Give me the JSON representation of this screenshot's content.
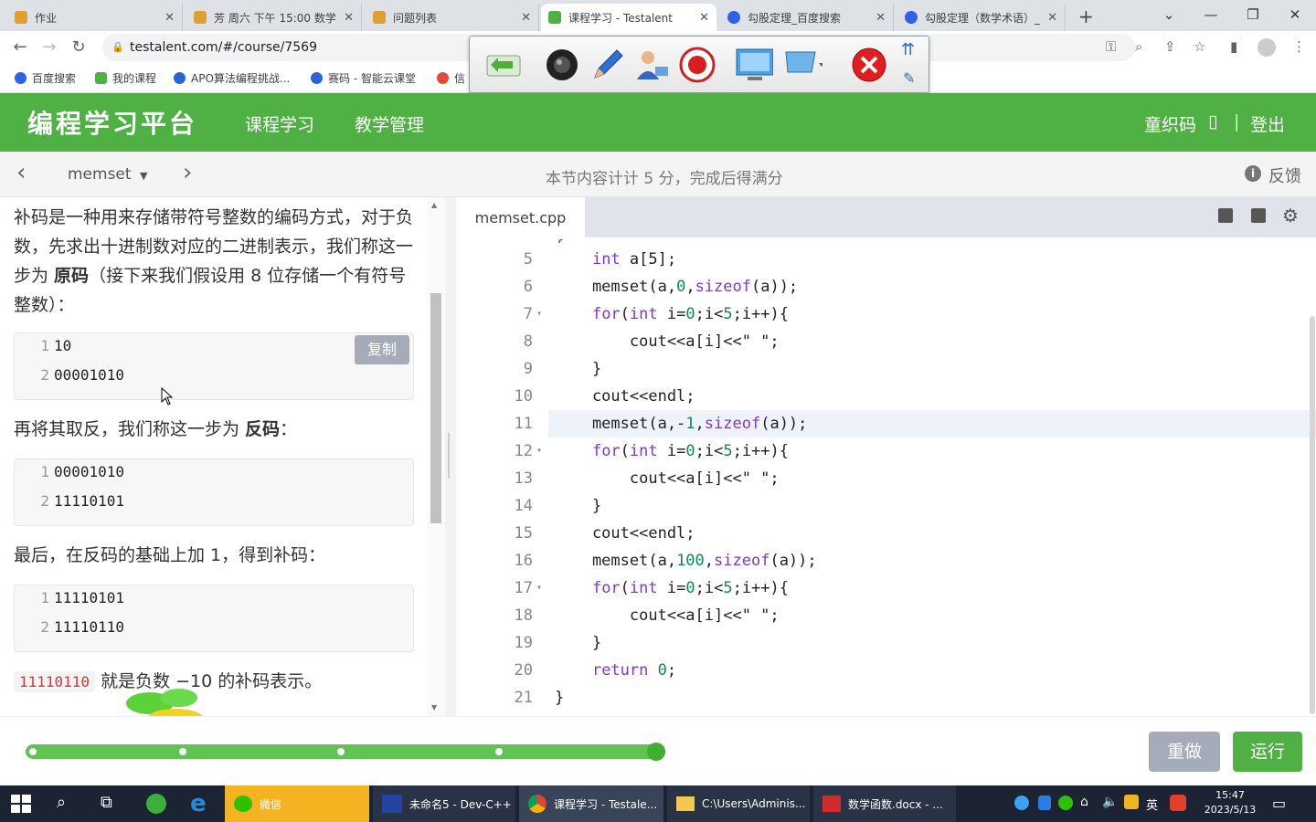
{
  "browser": {
    "tabs": [
      {
        "title": "作业",
        "color": "#e0a030"
      },
      {
        "title": "芳 周六 下午 15:00 数学",
        "color": "#e0a030"
      },
      {
        "title": "问题列表",
        "color": "#e0a030"
      },
      {
        "title": "课程学习 - Testalent",
        "color": "#4fb043",
        "active": true
      },
      {
        "title": "勾股定理_百度搜索",
        "color": "#3062e6"
      },
      {
        "title": "勾股定理（数学术语）_",
        "color": "#3062e6"
      }
    ],
    "new_tab": "+",
    "url": "testalent.com/#/course/7569",
    "bookmarks": [
      {
        "label": "百度搜索",
        "color": "#3062e6"
      },
      {
        "label": "我的课程",
        "color": "#4fb043"
      },
      {
        "label": "APO算法编程挑战...",
        "color": "#2b63d8"
      },
      {
        "label": "赛码 - 智能云课堂",
        "color": "#2b63d8"
      },
      {
        "label": "信",
        "color": "#e04a3a"
      }
    ]
  },
  "app": {
    "logo": "编程学习平台",
    "nav": [
      "课程学习",
      "教学管理"
    ],
    "user": "童织码",
    "user_icon": "▯",
    "separator": "|",
    "logout": "登出"
  },
  "subbar": {
    "prev": "‹",
    "next": "›",
    "lesson": "memset",
    "caret": "▼",
    "score_note": "本节内容计计 5 分，完成后得满分",
    "feedback_icon": "i",
    "feedback": "反馈"
  },
  "lesson": {
    "p1_a": "补码是一种用来存储带符号整数的编码方式，对于负数，先求出十进制数对应的二进制表示，我们称这一步为 ",
    "p1_bold": "原码",
    "p1_b": "（接下来我们假设用 8 位存储一个有符号整数）：",
    "block1": [
      {
        "n": "1",
        "t": "10"
      },
      {
        "n": "2",
        "t": "00001010"
      }
    ],
    "copy": "复制",
    "p2_a": "再将其取反，我们称这一步为 ",
    "p2_bold": "反码",
    "p2_b": "：",
    "block2": [
      {
        "n": "1",
        "t": "00001010"
      },
      {
        "n": "2",
        "t": "11110101"
      }
    ],
    "p3": "最后，在反码的基础上加 1，得到补码：",
    "block3": [
      {
        "n": "1",
        "t": "11110101"
      },
      {
        "n": "2",
        "t": "11110110"
      }
    ],
    "code_inline": "11110110",
    "p4": " 就是负数 −10 的补码表示。"
  },
  "editor": {
    "filename": "memset.cpp",
    "lines": [
      {
        "n": "5",
        "fold": "",
        "html": "    <span class='kw'>int</span> a[5];"
      },
      {
        "n": "6",
        "fold": "",
        "html": "    memset(a,<span class='num'>0</span>,<span class='kw'>sizeof</span>(a));"
      },
      {
        "n": "7",
        "fold": "▾",
        "html": "    <span class='kw'>for</span>(<span class='kw'>int</span> i=<span class='num'>0</span>;i&lt;<span class='num'>5</span>;i++){"
      },
      {
        "n": "8",
        "fold": "",
        "html": "        cout&lt;&lt;a[i]&lt;&lt;<span class='str'>\" \"</span>;"
      },
      {
        "n": "9",
        "fold": "",
        "html": "    }"
      },
      {
        "n": "10",
        "fold": "",
        "html": "    cout&lt;&lt;endl;"
      },
      {
        "n": "11",
        "fold": "",
        "html": "    memset(a,-<span class='num'>1</span>,<span class='kw'>sizeof</span>(a));",
        "hl": true
      },
      {
        "n": "12",
        "fold": "▾",
        "html": "    <span class='kw'>for</span>(<span class='kw'>int</span> i=<span class='num'>0</span>;i&lt;<span class='num'>5</span>;i++){"
      },
      {
        "n": "13",
        "fold": "",
        "html": "        cout&lt;&lt;a[i]&lt;&lt;<span class='str'>\" \"</span>;"
      },
      {
        "n": "14",
        "fold": "",
        "html": "    }"
      },
      {
        "n": "15",
        "fold": "",
        "html": "    cout&lt;&lt;endl;"
      },
      {
        "n": "16",
        "fold": "",
        "html": "    memset(a,<span class='num'>100</span>,<span class='kw'>sizeof</span>(a));"
      },
      {
        "n": "17",
        "fold": "▾",
        "html": "    <span class='kw'>for</span>(<span class='kw'>int</span> i=<span class='num'>0</span>;i&lt;<span class='num'>5</span>;i++){"
      },
      {
        "n": "18",
        "fold": "",
        "html": "        cout&lt;&lt;a[i]&lt;&lt;<span class='str'>\" \"</span>;"
      },
      {
        "n": "19",
        "fold": "",
        "html": "    }"
      },
      {
        "n": "20",
        "fold": "",
        "html": "    <span class='kw'>return</span> <span class='num'>0</span>;"
      },
      {
        "n": "21",
        "fold": "",
        "html": "}"
      }
    ]
  },
  "bottom": {
    "redo": "重做",
    "run": "运行",
    "progress_complete": 1.0
  },
  "taskbar": {
    "items": [
      "微信",
      "未命名5 - Dev-C++",
      "课程学习 - Testale...",
      "C:\\Users\\Adminis...",
      "数学函数.docx - ..."
    ],
    "time": "15:47",
    "date": "2023/5/13",
    "ime": "英"
  },
  "colors": {
    "brand": "#4fb043",
    "progress": "#5fc451",
    "button_gray": "#a5acb8"
  }
}
